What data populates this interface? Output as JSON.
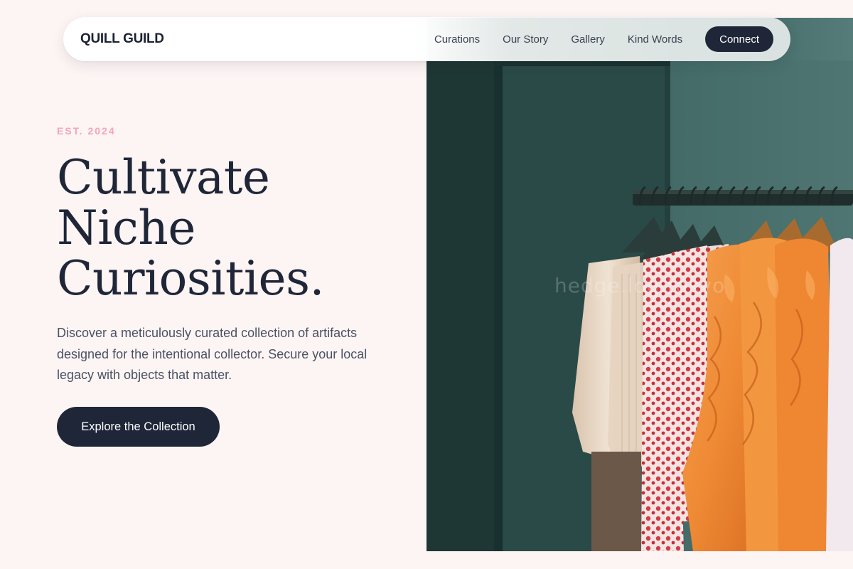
{
  "nav": {
    "brand": "QUILL GUILD",
    "links": [
      "Curations",
      "Our Story",
      "Gallery",
      "Kind Words"
    ],
    "cta_label": "Connect"
  },
  "hero": {
    "eyebrow": "EST. 2024",
    "headline": [
      "Cultivate",
      "Niche",
      "Curiosities."
    ],
    "description": "Discover a meticulously curated collection of artifacts designed for the intentional collector. Secure your local legacy with objects that matter.",
    "cta_label": "Explore the Collection",
    "image": {
      "subject": "clothing rack with hangers",
      "watermark": "hedge.log.tokyo"
    }
  },
  "colors": {
    "page_bg": "#fdf4f4",
    "ink": "#1f2638",
    "accent_pink": "#f2a6bd",
    "body_text": "#4a5263",
    "wall_teal": "#2f5553",
    "garment_orange": "#f08a3a",
    "garment_cream": "#e8d8c8",
    "garment_print": "#d8404a"
  }
}
